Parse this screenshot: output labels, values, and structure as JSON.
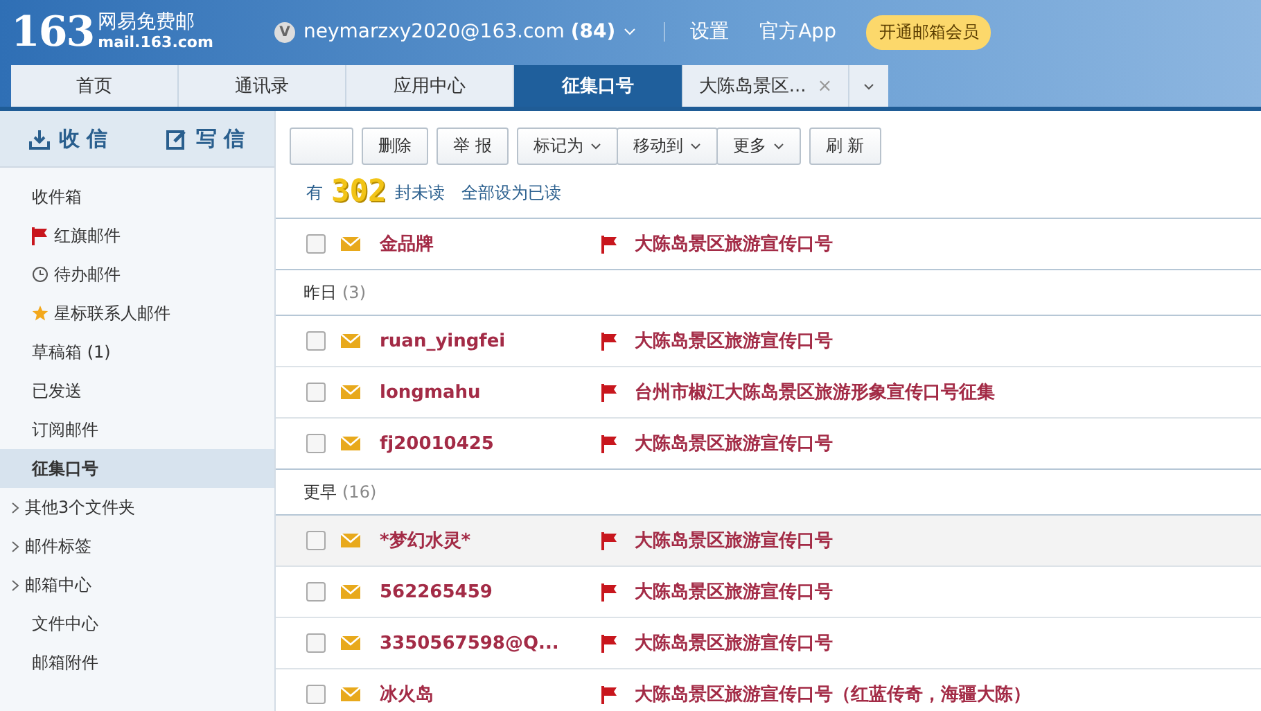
{
  "logo": {
    "number": "163",
    "name": "网易免费邮",
    "domain": "mail.163.com"
  },
  "account": {
    "badge": "V",
    "email": "neymarzxy2020@163.com",
    "count": "(84)"
  },
  "header_links": [
    "设置",
    "官方App"
  ],
  "vip_button": "开通邮箱会员",
  "tabs": [
    {
      "label": "首页",
      "selected": false
    },
    {
      "label": "通讯录",
      "selected": false
    },
    {
      "label": "应用中心",
      "selected": false
    },
    {
      "label": "征集口号",
      "selected": true
    },
    {
      "label": "大陈岛景区...",
      "selected": false,
      "close": "×"
    }
  ],
  "sidebar": {
    "receive": "收 信",
    "compose": "写 信",
    "items": [
      {
        "label": "收件箱",
        "kind": "plain",
        "selected": false
      },
      {
        "label": "红旗邮件",
        "kind": "flag",
        "selected": false
      },
      {
        "label": "待办邮件",
        "kind": "clock",
        "selected": false
      },
      {
        "label": "星标联系人邮件",
        "kind": "star",
        "selected": false
      },
      {
        "label": "草稿箱 (1)",
        "kind": "plain",
        "selected": false
      },
      {
        "label": "已发送",
        "kind": "plain",
        "selected": false
      },
      {
        "label": "订阅邮件",
        "kind": "plain",
        "selected": false
      },
      {
        "label": "征集口号",
        "kind": "plain",
        "selected": true
      },
      {
        "label": "其他3个文件夹",
        "kind": "collapsed",
        "selected": false
      },
      {
        "label": "邮件标签",
        "kind": "collapsed",
        "selected": false
      },
      {
        "label": "邮箱中心",
        "kind": "collapsed",
        "selected": false
      },
      {
        "label": "文件中心",
        "kind": "plain",
        "selected": false
      },
      {
        "label": "邮箱附件",
        "kind": "plain",
        "selected": false
      }
    ]
  },
  "toolbar": [
    {
      "kind": "button"
    },
    {
      "label": "删除",
      "kind": "button"
    },
    {
      "label": "举 报",
      "kind": "button"
    },
    {
      "label": "标记为",
      "kind": "dropdown"
    },
    {
      "label": "移动到",
      "kind": "dropdown"
    },
    {
      "label": "更多",
      "kind": "dropdown"
    },
    {
      "label": "刷 新",
      "kind": "button"
    }
  ],
  "unread": {
    "prefix": "有",
    "count": "302",
    "suffix": "封未读",
    "mark_all": "全部设为已读"
  },
  "groups": [
    {
      "mails": [
        {
          "sender": "金品牌",
          "subject": "大陈岛景区旅游宣传口号",
          "flagged": true,
          "checked": false,
          "hovered": false
        }
      ]
    },
    {
      "title": "昨日",
      "count": "(3)",
      "mails": [
        {
          "sender": "ruan_yingfei",
          "subject": "大陈岛景区旅游宣传口号",
          "flagged": true,
          "checked": false,
          "hovered": false
        },
        {
          "sender": "longmahu",
          "subject": "台州市椒江大陈岛景区旅游形象宣传口号征集",
          "flagged": true,
          "checked": false,
          "hovered": false
        },
        {
          "sender": "fj20010425",
          "subject": "大陈岛景区旅游宣传口号",
          "flagged": true,
          "checked": false,
          "hovered": false
        }
      ]
    },
    {
      "title": "更早",
      "count": "(16)",
      "mails": [
        {
          "sender": "*梦幻水灵*",
          "subject": "大陈岛景区旅游宣传口号",
          "flagged": true,
          "checked": false,
          "hovered": true
        },
        {
          "sender": "562265459",
          "subject": "大陈岛景区旅游宣传口号",
          "flagged": true,
          "checked": false,
          "hovered": false
        },
        {
          "sender": "3350567598@Q...",
          "subject": "大陈岛景区旅游宣传口号",
          "flagged": true,
          "checked": false,
          "hovered": false
        },
        {
          "sender": "冰火岛",
          "subject": "大陈岛景区旅游宣传口号（红蓝传奇，海疆大陈）",
          "flagged": true,
          "checked": false,
          "hovered": false
        }
      ]
    }
  ]
}
